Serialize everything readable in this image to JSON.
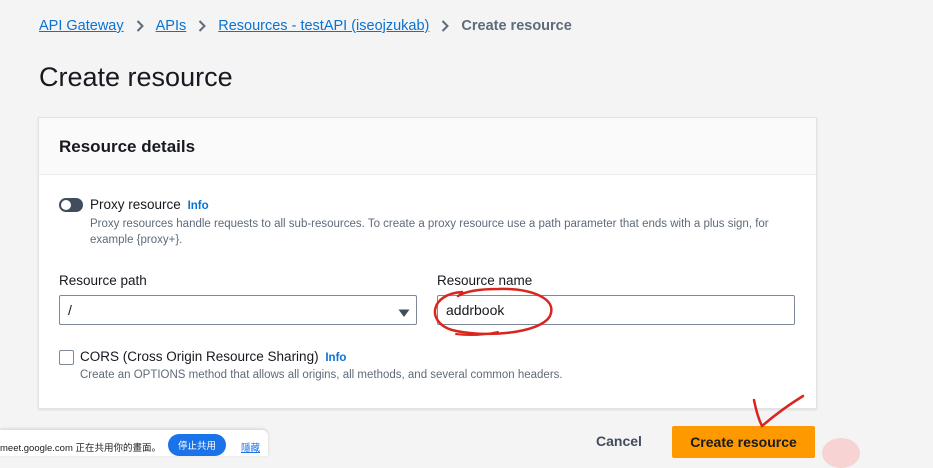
{
  "breadcrumb": {
    "items": [
      "API Gateway",
      "APIs",
      "Resources - testAPI (iseojzukab)"
    ],
    "current": "Create resource"
  },
  "page": {
    "title": "Create resource"
  },
  "panel": {
    "title": "Resource details",
    "proxy": {
      "label": "Proxy resource",
      "info": "Info",
      "description": "Proxy resources handle requests to all sub-resources. To create a proxy resource use a path parameter that ends with a plus sign, for example {proxy+}.",
      "enabled": false
    },
    "resource_path": {
      "label": "Resource path",
      "value": "/"
    },
    "resource_name": {
      "label": "Resource name",
      "value": "addrbook"
    },
    "cors": {
      "label": "CORS (Cross Origin Resource Sharing)",
      "info": "Info",
      "description": "Create an OPTIONS method that allows all origins, all methods, and several common headers.",
      "checked": false
    }
  },
  "actions": {
    "cancel": "Cancel",
    "create": "Create resource"
  },
  "meet_bar": {
    "text": "meet.google.com 正在共用你的畫面。",
    "stop": "停止共用",
    "hide": "隱藏"
  },
  "colors": {
    "link": "#0972d3",
    "primary_button": "#ff9900",
    "annotation": "#d8261f",
    "meet_blue": "#1a73e8"
  }
}
